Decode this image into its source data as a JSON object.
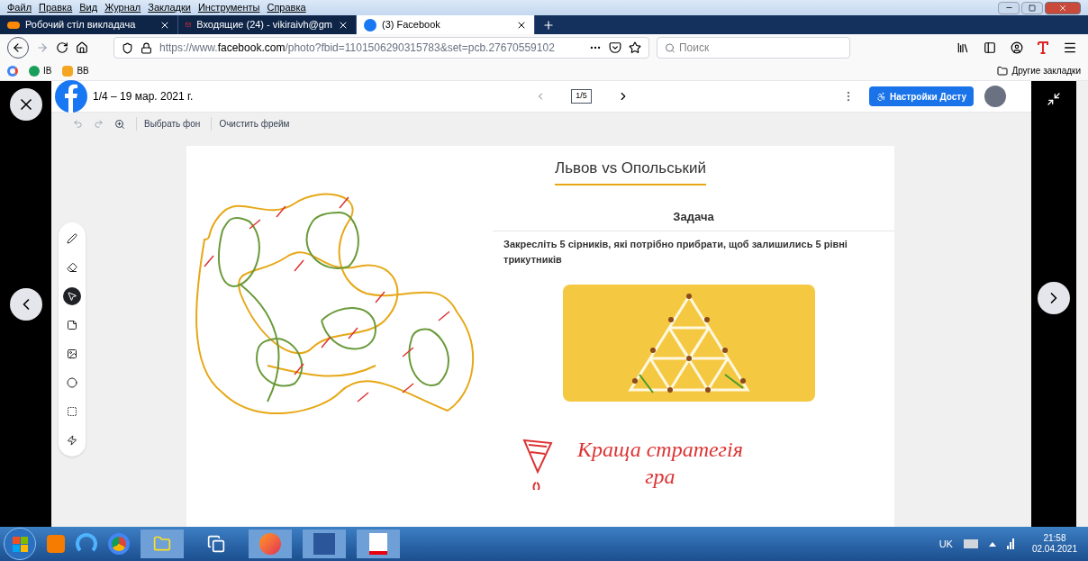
{
  "menu_bar": [
    "Файл",
    "Правка",
    "Вид",
    "Журнал",
    "Закладки",
    "Инструменты",
    "Справка"
  ],
  "tabs": [
    {
      "label": "Робочий стіл викладача",
      "kind": "jtg",
      "selected": false
    },
    {
      "label": "Входящие (24) - vikiraivh@gm",
      "kind": "mail",
      "selected": false
    },
    {
      "label": "(3) Facebook",
      "kind": "facebook",
      "selected": true
    }
  ],
  "address_bar": {
    "url": "https://www.**facebook.com**/photo?fbid=1101506290315783&set=pcb.27670559102"
  },
  "search": {
    "placeholder": "Поиск"
  },
  "bookmarks": [
    {
      "label": "IB",
      "kind": "map"
    },
    {
      "label": "BB",
      "kind": "meet"
    }
  ],
  "other_bookmarks": "Другие закладки",
  "viewer": {
    "date": "1/4 – 19 мар. 2021 г.",
    "pager": "1/5",
    "access_button": "Настройки Досту"
  },
  "whiteboard_toolbar": [
    "Выбрать фон",
    "Очистить фрейм"
  ],
  "tools": [
    {
      "kind": "pen",
      "selected": false
    },
    {
      "kind": "eraser",
      "selected": false
    },
    {
      "kind": "select",
      "selected": true
    },
    {
      "kind": "note",
      "selected": false
    },
    {
      "kind": "image",
      "selected": false
    },
    {
      "kind": "circle",
      "selected": false
    },
    {
      "kind": "text",
      "selected": false
    },
    {
      "kind": "laser",
      "selected": false
    }
  ],
  "slide": {
    "title": "Львов vs Опольський",
    "heading": "Задача",
    "task": "Закресліть 5 сірників, які потрібно прибрати, щоб залишились 5 рівні трикутників",
    "handwriting": [
      "Краща стратегія",
      "гра"
    ]
  },
  "taskbar": {
    "language": "UK",
    "time": "21:58",
    "date": "02.04.2021"
  }
}
